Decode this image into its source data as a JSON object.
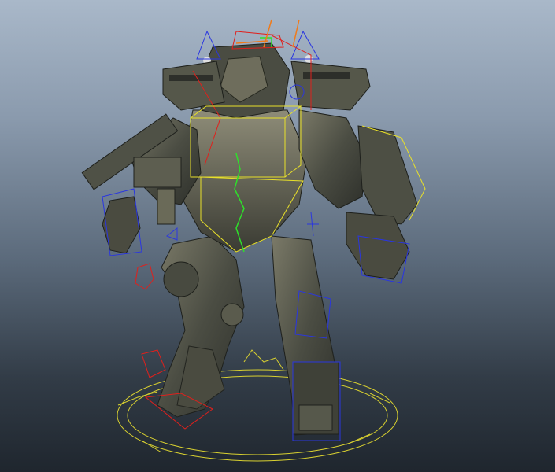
{
  "viewport": {
    "background_top": "#a9b8c9",
    "background_bottom": "#1f262e"
  },
  "colors": {
    "mesh_dark": "#3a3d36",
    "mesh_mid": "#5a5c50",
    "mesh_light": "#8d8c78",
    "rig_blue": "#2a36e0",
    "rig_red": "#e0201c",
    "rig_yellow": "#e8e02a",
    "rig_green": "#2ee02a",
    "rig_orange": "#f07a1a"
  },
  "scene": {
    "model": "mech-robot",
    "controls": [
      "ground-circle-control",
      "torso-box-control",
      "arm-fk-controls",
      "leg-ik-controls",
      "hand-controls",
      "finger-controls",
      "hip-control"
    ]
  }
}
